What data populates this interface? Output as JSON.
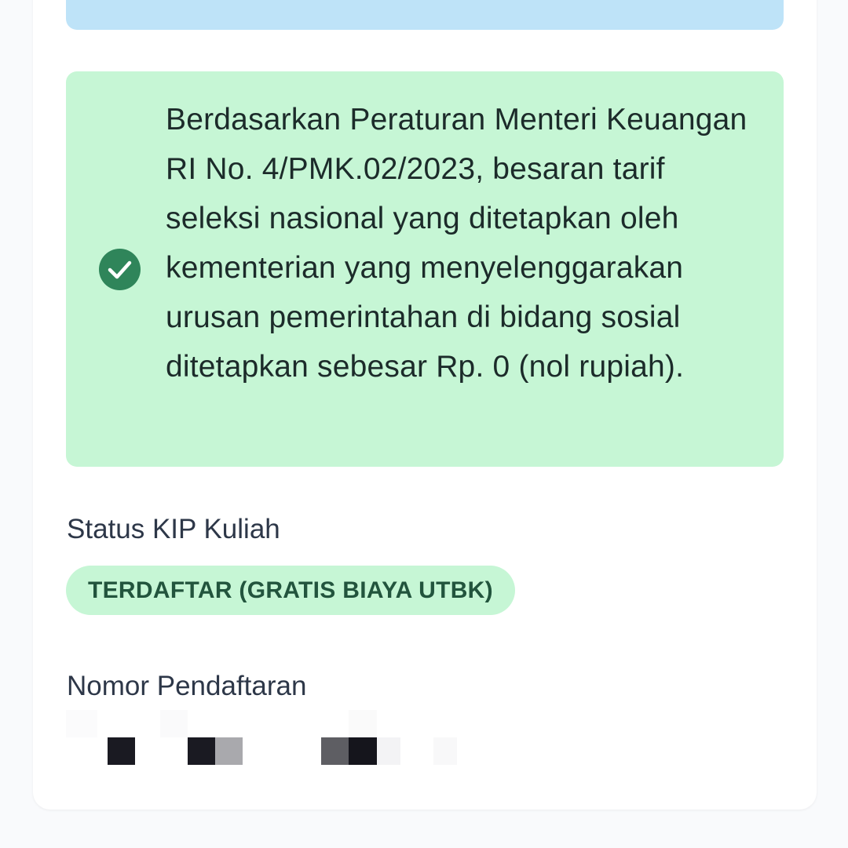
{
  "notice": {
    "text": "Berdasarkan Peraturan Menteri Keuangan RI No. 4/PMK.02/2023, besaran tarif seleksi nasional yang ditetapkan oleh kementerian yang menyelenggarakan urusan pemerintahan di bidang sosial ditetapkan sebesar Rp. 0 (nol rupiah).",
    "icon": "check-circle-icon"
  },
  "kip": {
    "label": "Status KIP Kuliah",
    "status": "TERDAFTAR (GRATIS BIAYA UTBK)"
  },
  "registration": {
    "label": "Nomor Pendaftaran"
  },
  "colors": {
    "info_bg": "#c6f6d5",
    "blue_bg": "#bee3f8",
    "check": "#2f855a",
    "badge_text": "#22543d"
  }
}
